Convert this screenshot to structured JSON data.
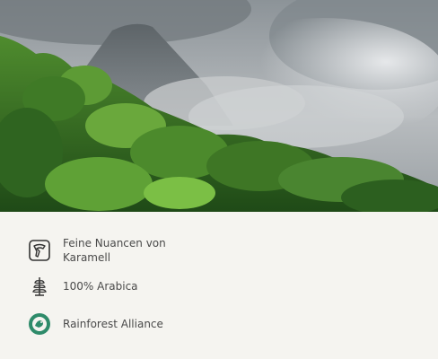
{
  "features": [
    {
      "icon": "caramel-icon",
      "label": "Feine Nuancen von\nKaramell"
    },
    {
      "icon": "plant-icon",
      "label": "100% Arabica"
    },
    {
      "icon": "rainforest-alliance-icon",
      "label": "Rainforest Alliance"
    }
  ],
  "colors": {
    "background": "#f5f4f0",
    "text": "#4a4a4a",
    "badge": "#2e8b6a"
  }
}
